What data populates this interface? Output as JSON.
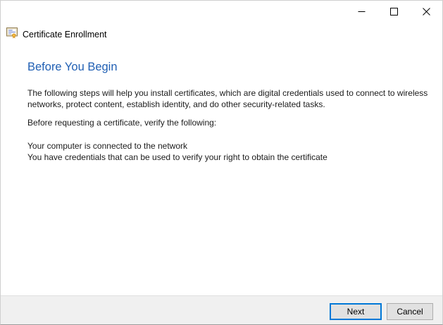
{
  "window": {
    "controls": {
      "minimize": "minimize-icon",
      "maximize": "maximize-icon",
      "close": "close-icon"
    }
  },
  "header": {
    "icon": "certificate-icon",
    "app_title": "Certificate Enrollment"
  },
  "content": {
    "heading": "Before You Begin",
    "intro": "The following steps will help you install certificates, which are digital credentials used to connect to wireless networks, protect content, establish identity, and do other security-related tasks.",
    "verify_prompt": "Before requesting a certificate, verify the following:",
    "verify_items": [
      "Your computer is connected to the network",
      "You have credentials that can be used to verify your right to obtain the certificate"
    ]
  },
  "footer": {
    "next_label": "Next",
    "cancel_label": "Cancel"
  },
  "colors": {
    "heading_blue": "#2160b4",
    "next_button_border": "#0078d7",
    "button_face": "#e1e1e1",
    "button_border": "#adadad",
    "footer_bg": "#f0f0f0",
    "footer_divider": "#dfdfdf"
  }
}
